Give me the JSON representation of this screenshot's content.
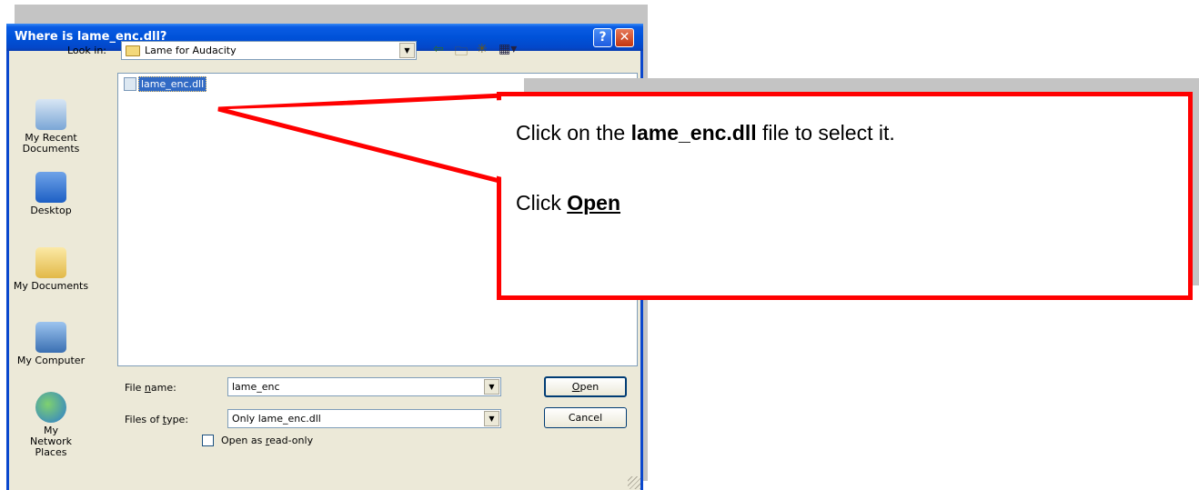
{
  "dialog": {
    "title": "Where is lame_enc.dll?",
    "help_button": "?",
    "close_button": "✕",
    "look_in_label": "Look in:",
    "look_in_value": "Lame for Audacity",
    "toolbar": {
      "back_icon": "back-arrow-icon",
      "up_icon": "up-folder-icon",
      "new_folder_icon": "new-folder-icon",
      "views_icon": "views-menu-icon"
    },
    "places": [
      {
        "label": "My Recent Documents",
        "icon": "recent-documents-icon"
      },
      {
        "label": "Desktop",
        "icon": "desktop-icon"
      },
      {
        "label": "My Documents",
        "icon": "my-documents-icon"
      },
      {
        "label": "My Computer",
        "icon": "my-computer-icon"
      },
      {
        "label": "My Network Places",
        "icon": "network-places-icon"
      }
    ],
    "files": [
      {
        "name": "lame_enc.dll",
        "selected": true
      }
    ],
    "file_name_label": "File name:",
    "file_name_value": "lame_enc",
    "files_of_type_label": "Files of type:",
    "files_of_type_value": "Only lame_enc.dll",
    "open_button": "Open",
    "cancel_button": "Cancel",
    "read_only_label": "Open as read-only",
    "read_only_checked": false
  },
  "callout": {
    "line1_prefix": "Click on the ",
    "line1_bold": "lame_enc.dll",
    "line1_suffix": " file to select it.",
    "line2_prefix": "Click ",
    "line2_bold": "Open"
  },
  "colors": {
    "titlebar": "#0052d9",
    "dialog_bg": "#ece9d8",
    "selection": "#316ac5",
    "callout_border": "#ff0000"
  }
}
